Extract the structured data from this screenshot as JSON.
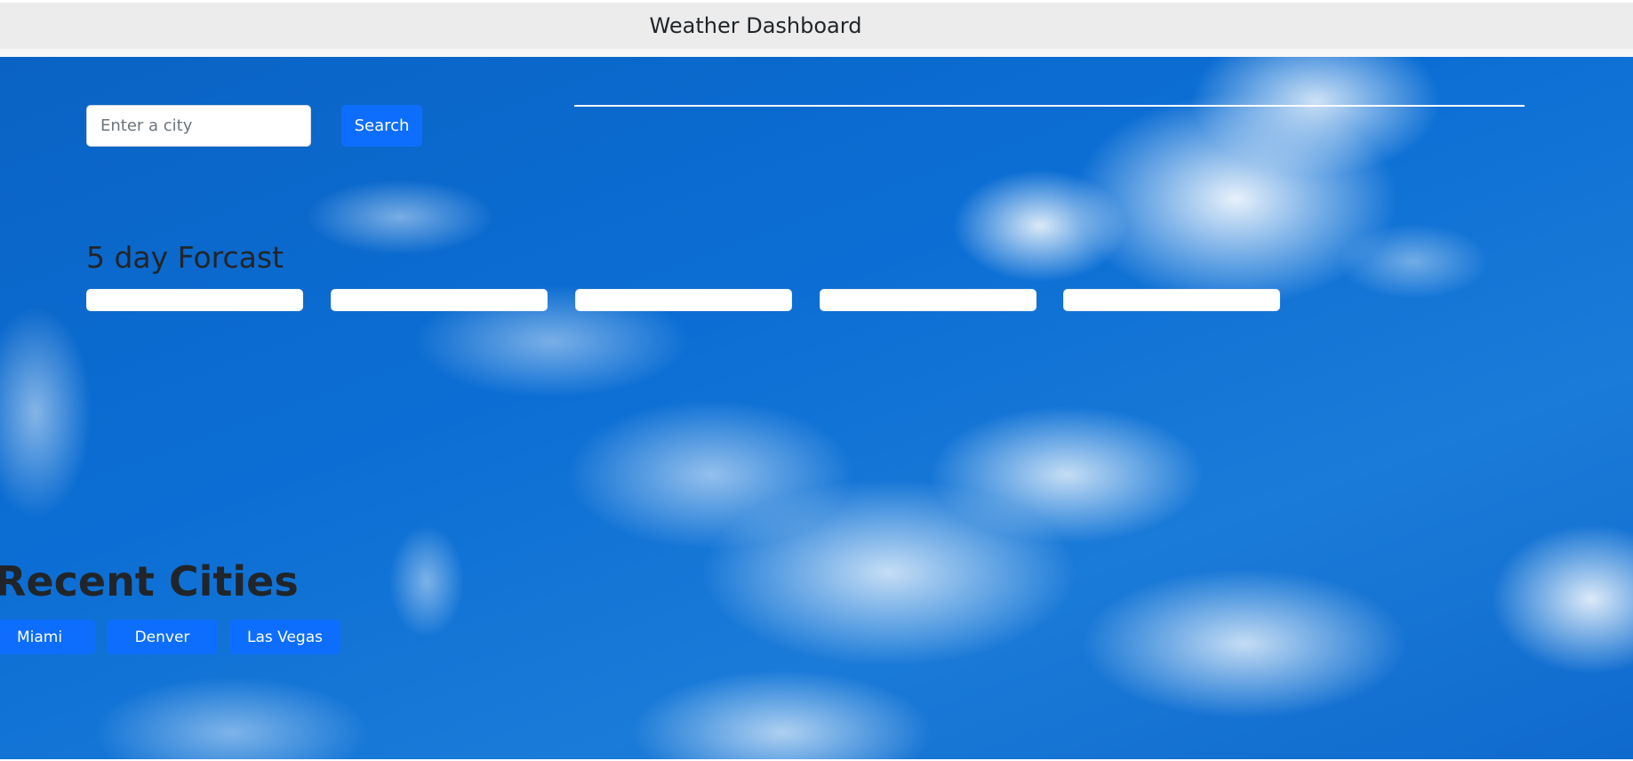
{
  "header": {
    "title": "Weather Dashboard"
  },
  "search": {
    "placeholder": "Enter a city",
    "value": "",
    "button_label": "Search"
  },
  "forecast": {
    "title": "5 day Forcast",
    "cards": [
      "",
      "",
      "",
      "",
      ""
    ]
  },
  "recent": {
    "title": "Recent Cities",
    "cities": [
      "Miami",
      "Denver",
      "Las Vegas"
    ]
  },
  "colors": {
    "header_bg": "#ececec",
    "button_bg": "#0d6efd",
    "sky": "#0c6ed4"
  }
}
